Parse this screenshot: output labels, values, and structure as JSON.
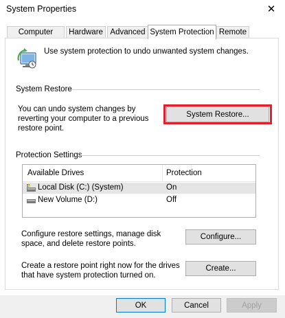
{
  "window": {
    "title": "System Properties",
    "close_glyph": "✕"
  },
  "tabs": [
    {
      "label": "Computer Name",
      "active": false
    },
    {
      "label": "Hardware",
      "active": false
    },
    {
      "label": "Advanced",
      "active": false
    },
    {
      "label": "System Protection",
      "active": true
    },
    {
      "label": "Remote",
      "active": false
    }
  ],
  "intro": {
    "text": "Use system protection to undo unwanted system changes.",
    "icon": "system-protection-icon"
  },
  "system_restore": {
    "section_label": "System Restore",
    "description": "You can undo system changes by reverting your computer to a previous restore point.",
    "button_label": "System Restore...",
    "highlight_color": "#e41e2b"
  },
  "protection_settings": {
    "section_label": "Protection Settings",
    "columns": [
      "Available Drives",
      "Protection"
    ],
    "drives": [
      {
        "name": "Local Disk (C:) (System)",
        "protection": "On",
        "icon": "system-drive-icon",
        "selected": true
      },
      {
        "name": "New Volume (D:)",
        "protection": "Off",
        "icon": "drive-icon",
        "selected": false
      }
    ],
    "configure_text": "Configure restore settings, manage disk space, and delete restore points.",
    "configure_label": "Configure...",
    "create_text": "Create a restore point right now for the drives that have system protection turned on.",
    "create_label": "Create..."
  },
  "footer": {
    "ok_label": "OK",
    "cancel_label": "Cancel",
    "apply_label": "Apply"
  },
  "colors": {
    "focus_border": "#0078d7",
    "button_face": "#e1e1e1",
    "selected_row": "#e5e5e5"
  }
}
